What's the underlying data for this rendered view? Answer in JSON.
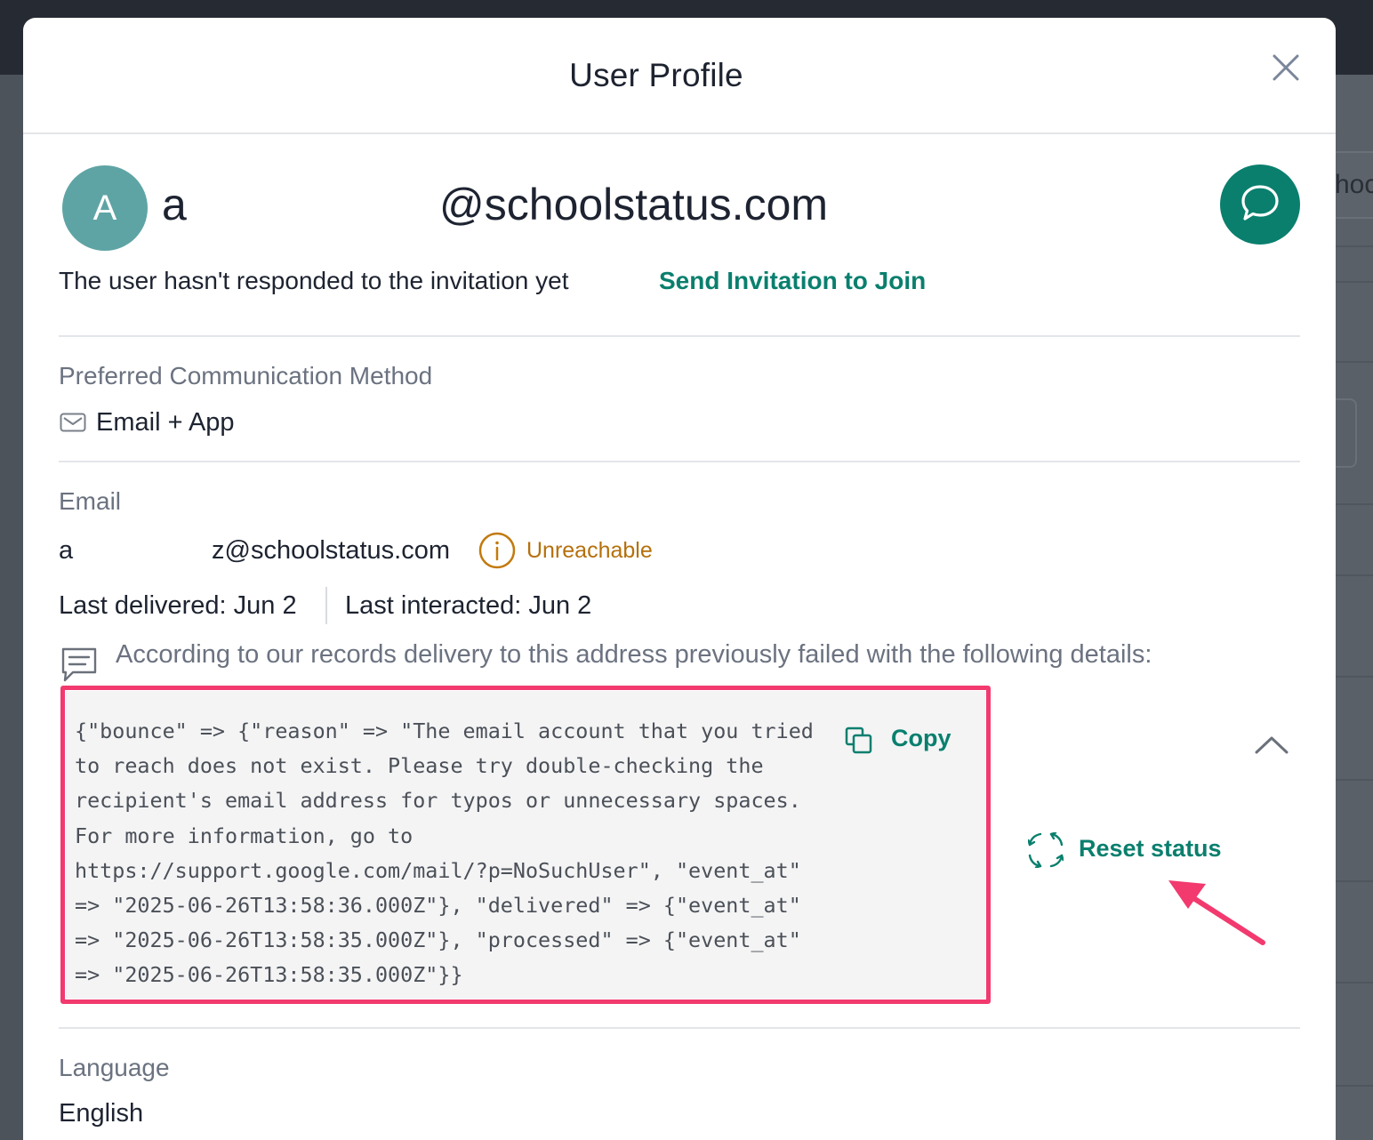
{
  "modal": {
    "title": "User Profile"
  },
  "user": {
    "avatar_initial": "A",
    "name_start": "a",
    "email_domain": "@schoolstatus.com",
    "invite_status": "The user hasn't responded to the invitation yet",
    "invite_link": "Send Invitation to Join"
  },
  "communication": {
    "label": "Preferred Communication Method",
    "icon": "mail-icon",
    "value": "Email + App"
  },
  "email": {
    "label": "Email",
    "address_start": "a",
    "address_end": "z@schoolstatus.com",
    "status": "Unreachable",
    "status_color": "#b5700c",
    "last_delivered": "Last delivered: Jun 2",
    "last_interacted": "Last interacted: Jun 2",
    "failure_note": "According to our records delivery to this address previously failed with the following details:",
    "failure_details": "{\"bounce\" => {\"reason\" => \"The email account that you tried to reach does not exist. Please try double-checking the recipient's email address for typos or unnecessary spaces. For more information, go to https://support.google.com/mail/?p=NoSuchUser\", \"event_at\" => \"2025-06-26T13:58:36.000Z\"}, \"delivered\" => {\"event_at\" => \"2025-06-26T13:58:35.000Z\"}, \"processed\" => {\"event_at\" => \"2025-06-26T13:58:35.000Z\"}}",
    "copy_label": "Copy",
    "reset_label": "Reset status"
  },
  "language": {
    "label": "Language",
    "value": "English"
  },
  "background": {
    "partial_text": "hoc"
  },
  "colors": {
    "accent": "#0a7f6e",
    "highlight": "#f23a6f",
    "avatar": "#5fa4a5",
    "warning": "#b5700c"
  }
}
